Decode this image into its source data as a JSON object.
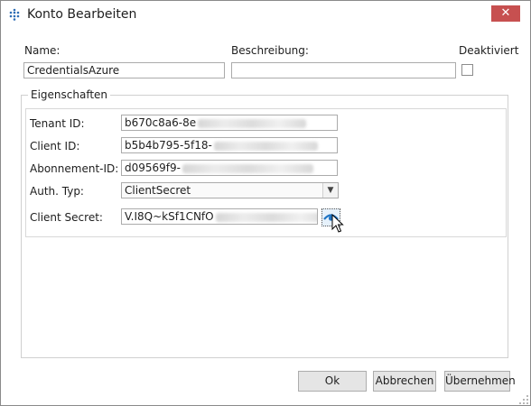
{
  "window": {
    "title": "Konto Bearbeiten",
    "close_glyph": "✕"
  },
  "form": {
    "name_label": "Name:",
    "name_value": "CredentialsAzure",
    "description_label": "Beschreibung:",
    "description_value": "",
    "disabled_label": "Deaktiviert"
  },
  "properties": {
    "group_title": "Eigenschaften",
    "tenant_id_label": "Tenant ID:",
    "tenant_id_value": "b670c8a6-8e",
    "client_id_label": "Client ID:",
    "client_id_value": "b5b4b795-5f18-",
    "subscription_id_label": "Abonnement-ID:",
    "subscription_id_value": "d09569f9-",
    "auth_type_label": "Auth. Typ:",
    "auth_type_value": "ClientSecret",
    "client_secret_label": "Client Secret:",
    "client_secret_value": "V.I8Q~kSf1CNfO"
  },
  "buttons": {
    "ok": "Ok",
    "cancel": "Abbrechen",
    "apply": "Übernehmen"
  },
  "icons": {
    "app": "grid-dots-icon",
    "reveal": "eye-icon",
    "cursor": "mouse-pointer-icon"
  },
  "colors": {
    "close_button": "#c75050",
    "app_icon": "#2d6db5",
    "eye_button": "#1f74c4"
  }
}
